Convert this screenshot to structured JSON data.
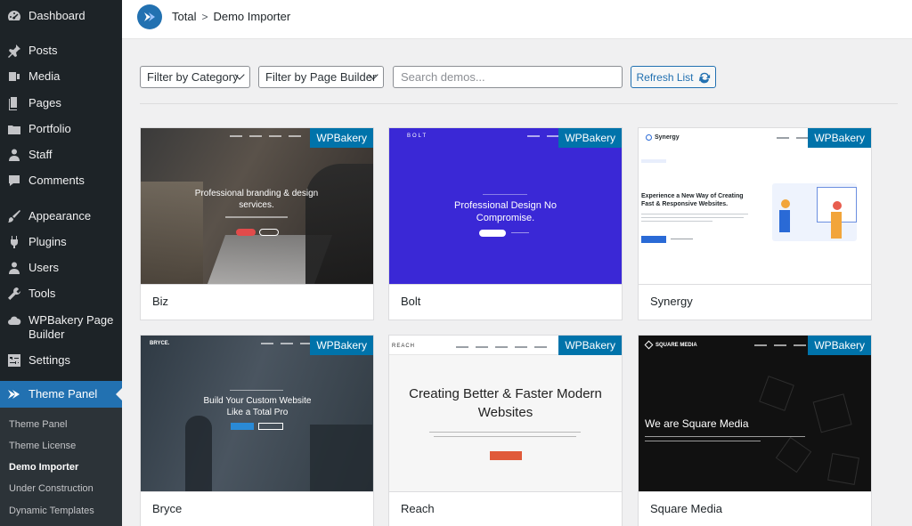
{
  "sidebar": {
    "items": [
      {
        "label": "Dashboard",
        "icon": "dashboard-icon"
      },
      {
        "label": "Posts",
        "icon": "pin-icon"
      },
      {
        "label": "Media",
        "icon": "media-icon"
      },
      {
        "label": "Pages",
        "icon": "pages-icon"
      },
      {
        "label": "Portfolio",
        "icon": "folder-icon"
      },
      {
        "label": "Staff",
        "icon": "user-icon"
      },
      {
        "label": "Comments",
        "icon": "comment-icon"
      },
      {
        "label": "Appearance",
        "icon": "brush-icon"
      },
      {
        "label": "Plugins",
        "icon": "plug-icon"
      },
      {
        "label": "Users",
        "icon": "users-icon"
      },
      {
        "label": "Tools",
        "icon": "wrench-icon"
      },
      {
        "label": "WPBakery Page Builder",
        "icon": "cloud-icon"
      },
      {
        "label": "Settings",
        "icon": "settings-icon"
      },
      {
        "label": "Theme Panel",
        "icon": "theme-panel-icon"
      }
    ],
    "submenu": [
      {
        "label": "Theme Panel"
      },
      {
        "label": "Theme License"
      },
      {
        "label": "Demo Importer",
        "current": true
      },
      {
        "label": "Under Construction"
      },
      {
        "label": "Dynamic Templates"
      }
    ]
  },
  "header": {
    "breadcrumb": [
      "Total",
      "Demo Importer"
    ],
    "separator": ">"
  },
  "filters": {
    "category": "Filter by Category",
    "page_builder": "Filter by Page Builder",
    "search_placeholder": "Search demos...",
    "refresh_label": "Refresh List"
  },
  "demos": [
    {
      "name": "Biz",
      "badge": "WPBakery",
      "headline": "Professional branding & design services."
    },
    {
      "name": "Bolt",
      "badge": "WPBakery",
      "logo": "BOLT",
      "headline": "Professional Design No Compromise."
    },
    {
      "name": "Synergy",
      "badge": "WPBakery",
      "logo": "Synergy",
      "headline": "Experience a New Way of Creating Fast & Responsive Websites."
    },
    {
      "name": "Bryce",
      "badge": "WPBakery",
      "logo": "BRYCE.",
      "headline": "Build Your Custom Website Like a Total Pro"
    },
    {
      "name": "Reach",
      "badge": "WPBakery",
      "logo": "REACH",
      "headline": "Creating Better & Faster Modern Websites"
    },
    {
      "name": "Square Media",
      "badge": "WPBakery",
      "logo": "SQUARE MEDIA",
      "headline": "We are Square Media"
    }
  ],
  "colors": {
    "sidebar_bg": "#1d2327",
    "accent": "#2271b1",
    "badge": "#0073aa",
    "bolt_bg": "#3a28d6"
  }
}
